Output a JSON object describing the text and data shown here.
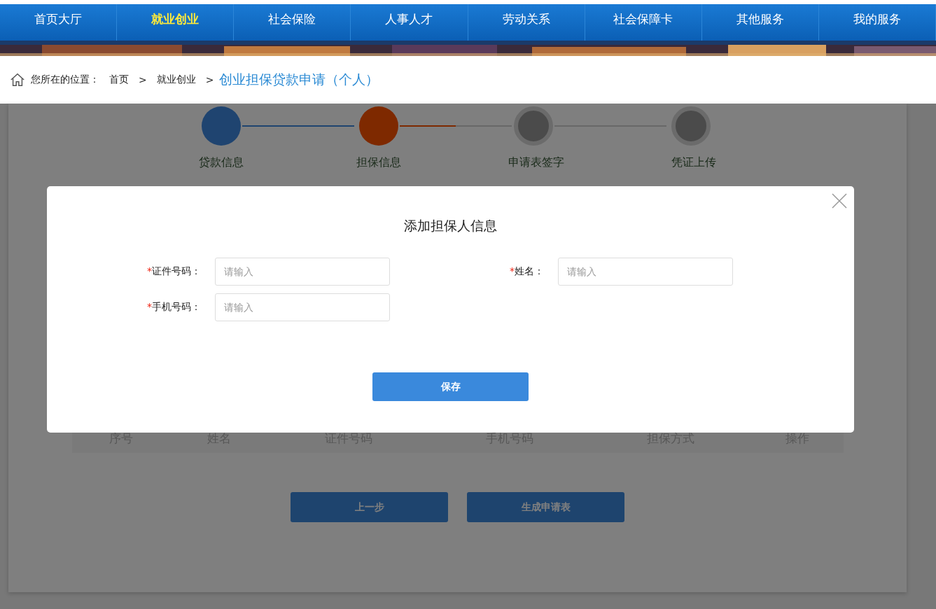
{
  "nav": [
    {
      "label": "首页大厅",
      "selected": false
    },
    {
      "label": "就业创业",
      "selected": true
    },
    {
      "label": "社会保险",
      "selected": false
    },
    {
      "label": "人事人才",
      "selected": false
    },
    {
      "label": "劳动关系",
      "selected": false
    },
    {
      "label": "社会保障卡",
      "selected": false
    },
    {
      "label": "其他服务",
      "selected": false
    },
    {
      "label": "我的服务",
      "selected": false
    }
  ],
  "breadcrumb": {
    "prefix": "您所在的位置：",
    "links": [
      "首页",
      "就业创业"
    ],
    "separator": ">",
    "current": "创业担保贷款申请（个人）"
  },
  "steps": [
    {
      "label": "贷款信息",
      "completed": true,
      "selected": false
    },
    {
      "label": "担保信息",
      "completed": false,
      "selected": true
    },
    {
      "label": "申请表签字",
      "completed": false,
      "selected": false
    },
    {
      "label": "凭证上传",
      "completed": false,
      "selected": false
    }
  ],
  "table": {
    "columns": [
      "序号",
      "姓名",
      "证件号码",
      "手机号码",
      "担保方式",
      "操作"
    ]
  },
  "buttons": [
    "上一步",
    "生成申请表"
  ],
  "dialog": {
    "title": "添加担保人信息",
    "fields": [
      {
        "label": "证件号码：",
        "placeholder": "请输入",
        "required": true
      },
      {
        "label": "姓名：",
        "placeholder": "请输入",
        "required": true
      },
      {
        "label": "手机号码：",
        "placeholder": "请输入",
        "required": true
      }
    ],
    "required_mark": "*",
    "save": "保存"
  }
}
